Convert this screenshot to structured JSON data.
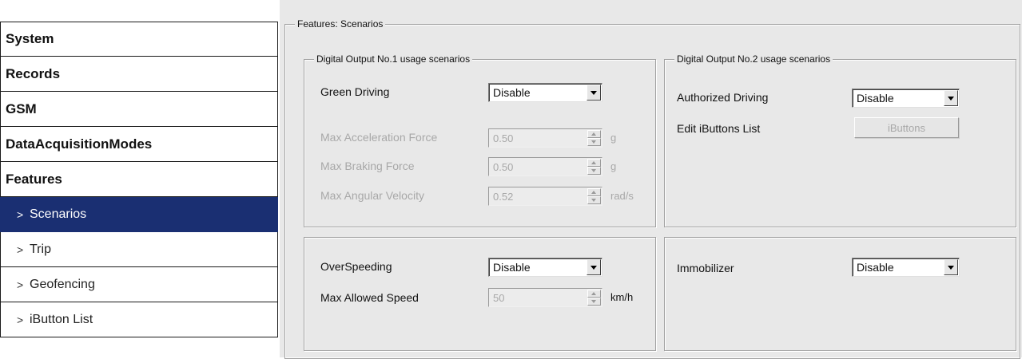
{
  "sidebar": {
    "items": [
      {
        "label": "System"
      },
      {
        "label": "Records"
      },
      {
        "label": "GSM"
      },
      {
        "label": "DataAcquisitionModes"
      },
      {
        "label": "Features"
      },
      {
        "label": "Scenarios",
        "arrow": ">"
      },
      {
        "label": "Trip",
        "arrow": ">"
      },
      {
        "label": "Geofencing",
        "arrow": ">"
      },
      {
        "label": "iButton List",
        "arrow": ">"
      }
    ],
    "active": "Scenarios",
    "active_color": "#1a2f72"
  },
  "main": {
    "section_title": "Features: Scenarios",
    "dout1": {
      "title": "Digital Output No.1 usage scenarios",
      "green_driving": {
        "label": "Green Driving",
        "value": "Disable"
      },
      "max_accel": {
        "label": "Max Acceleration Force",
        "value": "0.50",
        "unit": "g"
      },
      "max_braking": {
        "label": "Max Braking Force",
        "value": "0.50",
        "unit": "g"
      },
      "max_angular": {
        "label": "Max Angular Velocity",
        "value": "0.52",
        "unit": "rad/s"
      }
    },
    "dout2": {
      "title": "Digital Output No.2 usage scenarios",
      "authorized_driving": {
        "label": "Authorized Driving",
        "value": "Disable"
      },
      "edit_ibuttons": {
        "label": "Edit iButtons List",
        "button": "iButtons"
      }
    },
    "overspeed": {
      "label": "OverSpeeding",
      "value": "Disable",
      "max_speed": {
        "label": "Max Allowed Speed",
        "value": "50",
        "unit": "km/h"
      }
    },
    "immobilizer": {
      "label": "Immobilizer",
      "value": "Disable"
    }
  }
}
